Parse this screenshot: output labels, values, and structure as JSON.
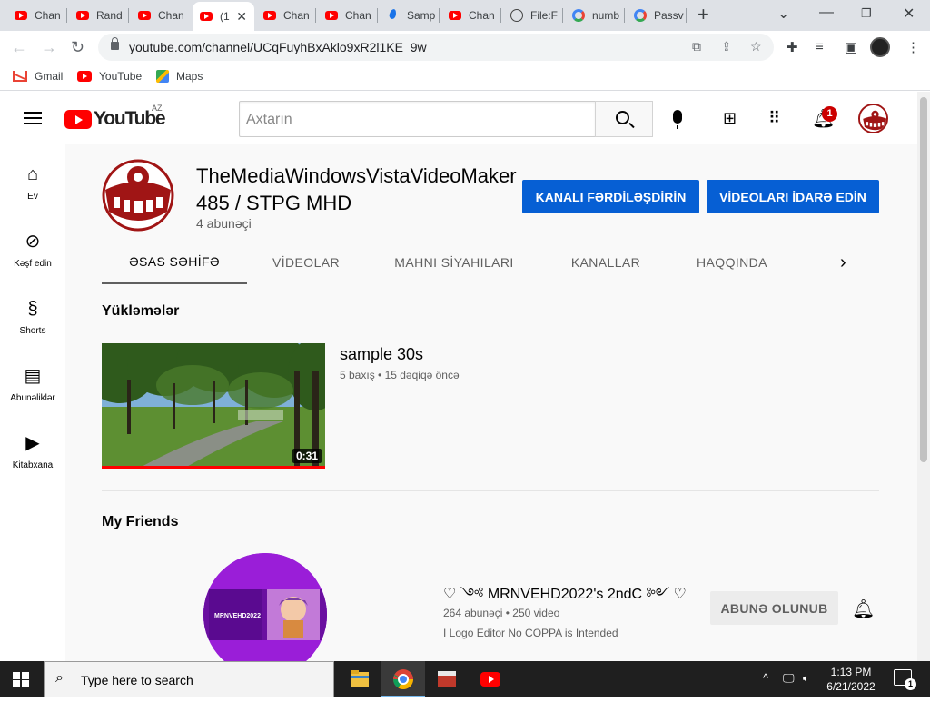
{
  "browser": {
    "tabs": [
      {
        "title": "Chan",
        "icon": "youtube-icon"
      },
      {
        "title": "Rand",
        "icon": "youtube-icon"
      },
      {
        "title": "Chan",
        "icon": "youtube-icon"
      },
      {
        "title": "(1",
        "icon": "youtube-icon",
        "active": true
      },
      {
        "title": "Chan",
        "icon": "youtube-icon"
      },
      {
        "title": "Chan",
        "icon": "youtube-icon"
      },
      {
        "title": "Samp",
        "icon": "drop-icon"
      },
      {
        "title": "Chan",
        "icon": "youtube-icon"
      },
      {
        "title": "File:F",
        "icon": "wikipedia-icon"
      },
      {
        "title": "numb",
        "icon": "google-icon"
      },
      {
        "title": "Passv",
        "icon": "google-icon"
      }
    ],
    "url": "youtube.com/channel/UCqFuyhBxAklo9xR2l1KE_9w",
    "bookmarks": [
      "Gmail",
      "YouTube",
      "Maps"
    ]
  },
  "yt": {
    "logo_word": "YouTube",
    "country_code": "AZ",
    "search_placeholder": "Axtarın",
    "notification_count": "1"
  },
  "guide": [
    {
      "label": "Ev",
      "icon": "home-icon"
    },
    {
      "label": "Kəşf edin",
      "icon": "compass-icon"
    },
    {
      "label": "Shorts",
      "icon": "shorts-icon"
    },
    {
      "label": "Abunəliklər",
      "icon": "subscriptions-icon"
    },
    {
      "label": "Kitabxana",
      "icon": "library-icon"
    }
  ],
  "channel": {
    "name": "TheMediaWindowsVistaVideoMaker485 / STPG MHD",
    "subscribers": "4 abunəçi",
    "customize_button": "KANALI FƏRDİLƏŞDİRİN",
    "manage_button": "VİDEOLARI İDARƏ EDİN",
    "tabs": [
      "ƏSAS SƏHİFƏ",
      "VİDEOLAR",
      "MAHNI SİYAHILARI",
      "KANALLAR",
      "HAQQINDA"
    ]
  },
  "uploads": {
    "title": "Yükləmələr",
    "video": {
      "title": "sample 30s",
      "views": "5 baxış",
      "age": "15 dəqiqə öncə",
      "duration": "0:31"
    }
  },
  "friends": {
    "title": "My Friends",
    "channel": {
      "name": "♡ ༺ MRNVEHD2022's 2ndC ༻ ♡",
      "subscribers": "264 abunəçi",
      "videos": "250 video",
      "description": "I Logo Editor No COPPA is Intended",
      "subscribe_button": "ABUNƏ OLUNUB",
      "avatar_text": "MRNVEHD2022"
    }
  },
  "taskbar": {
    "search_placeholder": "Type here to search",
    "time": "1:13 PM",
    "date": "6/21/2022",
    "notification_count": "1"
  }
}
